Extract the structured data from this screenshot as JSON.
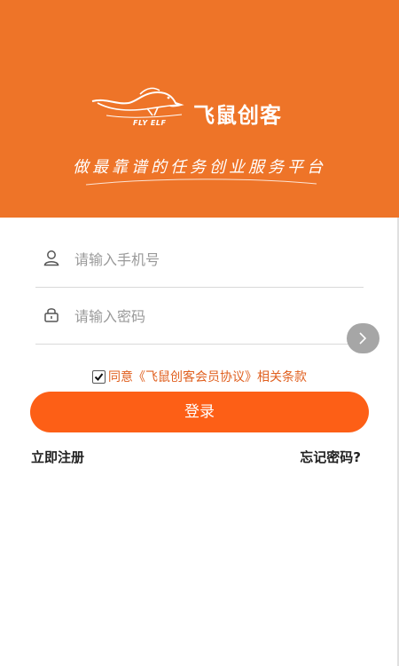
{
  "header": {
    "brand_name": "飞鼠创客",
    "brand_en": "FLY ELF",
    "slogan": "做最靠谱的任务创业服务平台",
    "background_color": "#ee7428"
  },
  "form": {
    "phone": {
      "placeholder": "请输入手机号",
      "icon": "user-icon"
    },
    "password": {
      "placeholder": "请输入密码",
      "icon": "lock-icon"
    },
    "agreement": {
      "text": "同意《飞鼠创客会员协议》相关条款",
      "checked": true
    },
    "login_label": "登录",
    "register_label": "立即注册",
    "forgot_label": "忘记密码?",
    "button_color": "#fd5f16"
  }
}
